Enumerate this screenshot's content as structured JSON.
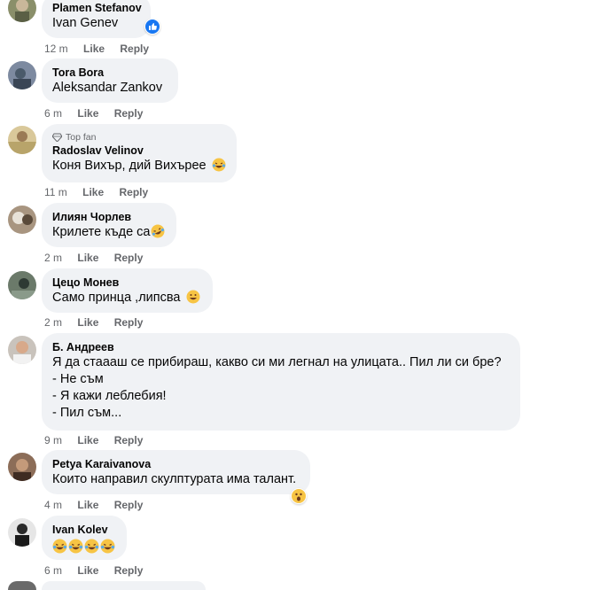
{
  "comments": [
    {
      "author": "Plamen Stefanov",
      "text": "Ivan Genev",
      "time": "12 m",
      "like": "Like",
      "reply": "Reply",
      "reaction": "like-reaction-icon"
    },
    {
      "author": "Tora Bora",
      "text": "Aleksandar Zankov",
      "time": "6 m",
      "like": "Like",
      "reply": "Reply"
    },
    {
      "badge": "Top fan",
      "author": "Radoslav Velinov",
      "text": "Коня Вихър, дий Вихърее",
      "time": "11 m",
      "like": "Like",
      "reply": "Reply",
      "emoji": "laughing-tears-emoji"
    },
    {
      "author": "Илиян Чорлев",
      "text": "Крилете къде са",
      "time": "2 m",
      "like": "Like",
      "reply": "Reply",
      "emoji": "rolling-laughing-emoji"
    },
    {
      "author": "Цецо Монев",
      "text": "Само принца ,липсва",
      "time": "2 m",
      "like": "Like",
      "reply": "Reply",
      "emoji": "grinning-emoji"
    },
    {
      "author": "Б. Андреев",
      "lines": [
        "Я да стаааш се прибираш, какво си ми легнал на улицата.. Пил ли си бре?",
        "- Не съм",
        "- Я кажи леблебия!",
        "- Пил съм..."
      ],
      "time": "9 m",
      "like": "Like",
      "reply": "Reply"
    },
    {
      "author": "Petya Karaivanova",
      "text": "Които направил скулптурата има талант.",
      "time": "4 m",
      "like": "Like",
      "reply": "Reply",
      "reaction": "wow-reaction-icon"
    },
    {
      "author": "Ivan Kolev",
      "text": "",
      "time": "6 m",
      "like": "Like",
      "reply": "Reply",
      "emoji": "laughing-tears-emoji x4"
    }
  ],
  "colors": {
    "bubble": "#f0f2f5",
    "meta": "#65676b",
    "like_blue": "#1877f2",
    "emoji_yellow": "#f7c444"
  }
}
